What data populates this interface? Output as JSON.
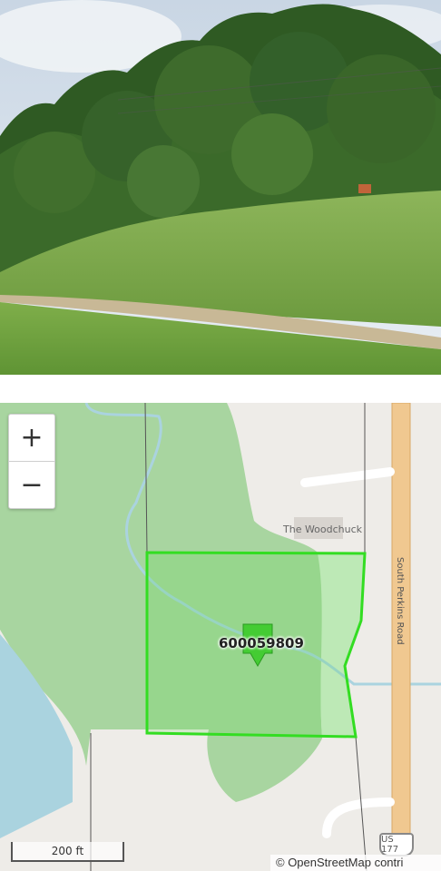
{
  "photo": {
    "scene": "roadside-grass-and-trees"
  },
  "map": {
    "zoom_in_label": "+",
    "zoom_out_label": "−",
    "poi_label": "The Woodchuck",
    "road_label": "South Perkins Road",
    "parcel_id": "600059809",
    "route_badge": "US 177",
    "scale_label": "200 ft",
    "attribution": "© OpenStreetMap contri",
    "colors": {
      "forest": "#a8d5a0",
      "parcel_outline": "#33dd22",
      "water": "#aad3df",
      "road": "#f0c890",
      "background": "#eeece8"
    }
  }
}
